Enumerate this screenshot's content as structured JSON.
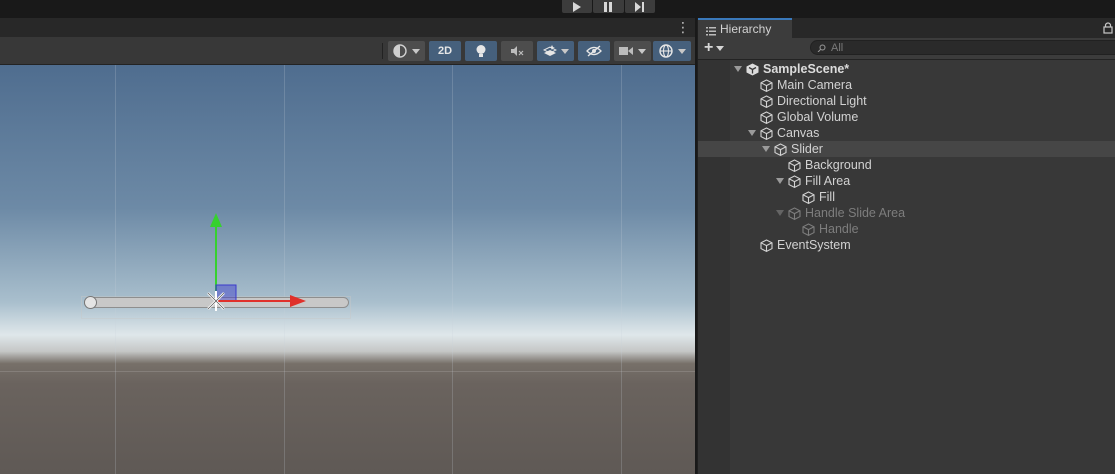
{
  "topbar": {
    "play_icon": "play-icon",
    "pause_icon": "pause-icon",
    "step_icon": "step-icon"
  },
  "scene_toolbar": {
    "shading_icon": "shading-mode-icon",
    "mode_2d_label": "2D",
    "lighting_icon": "lightbulb-icon",
    "audio_icon": "audio-muted-icon",
    "fx_icon": "effects-icon",
    "visibility_icon": "hidden-visibility-icon",
    "camera_icon": "camera-icon",
    "gizmos_icon": "gizmos-icon"
  },
  "hierarchy": {
    "tab_label": "Hierarchy",
    "tab_icon": "list-icon",
    "add_label": "+",
    "search_placeholder": "All",
    "search_value": "",
    "items": [
      {
        "label": "SampleScene*",
        "depth": 0,
        "expanded": true,
        "scene": true
      },
      {
        "label": "Main Camera",
        "depth": 1
      },
      {
        "label": "Directional Light",
        "depth": 1
      },
      {
        "label": "Global Volume",
        "depth": 1
      },
      {
        "label": "Canvas",
        "depth": 1,
        "expanded": true
      },
      {
        "label": "Slider",
        "depth": 2,
        "expanded": true,
        "selected": true
      },
      {
        "label": "Background",
        "depth": 3
      },
      {
        "label": "Fill Area",
        "depth": 3,
        "expanded": true
      },
      {
        "label": "Fill",
        "depth": 4
      },
      {
        "label": "Handle Slide Area",
        "depth": 3,
        "expanded": true,
        "disabled": true
      },
      {
        "label": "Handle",
        "depth": 4,
        "disabled": true
      },
      {
        "label": "EventSystem",
        "depth": 1
      }
    ]
  },
  "colors": {
    "selected_tab_accent": "#3a79bb",
    "toggle_active": "#46607c",
    "gizmo_x": "#e0302a",
    "gizmo_y": "#36d12e",
    "gizmo_z": "#3a3acc"
  }
}
